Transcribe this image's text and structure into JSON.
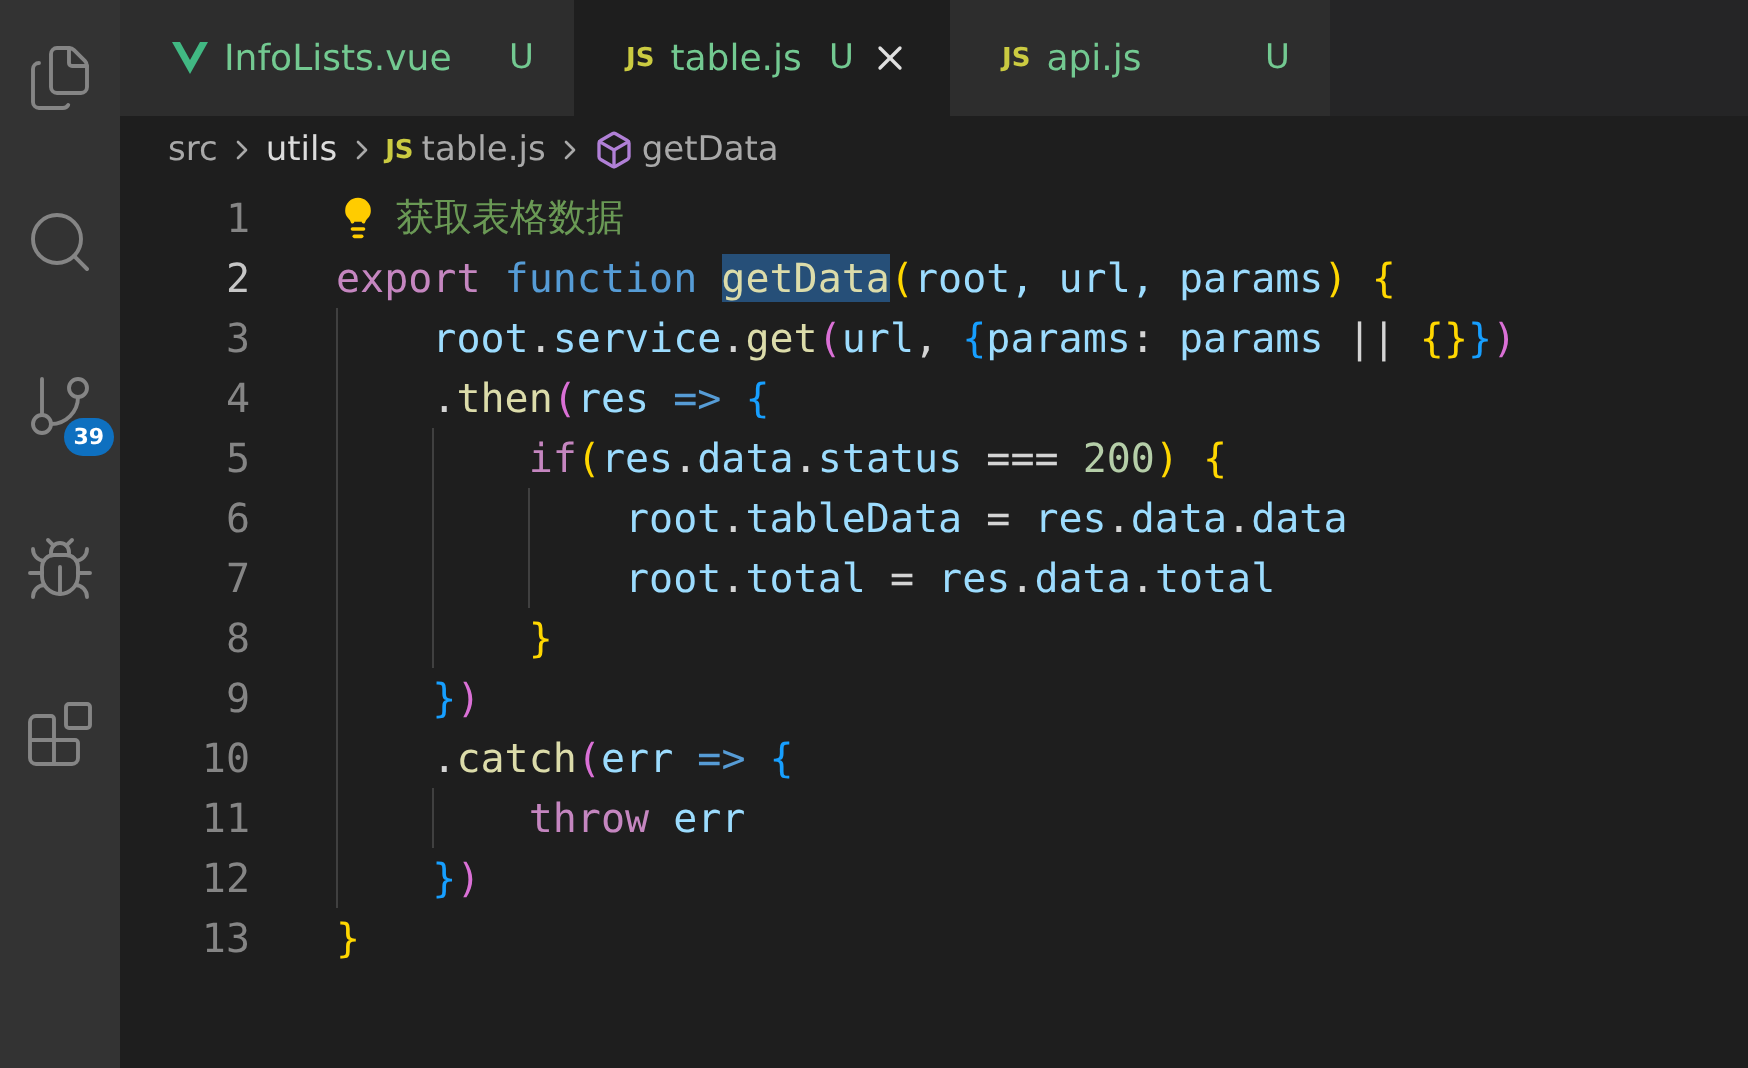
{
  "activity_bar": {
    "items": [
      {
        "kind": "files",
        "selected": false
      },
      {
        "kind": "search",
        "selected": false
      },
      {
        "kind": "source_control",
        "selected": false,
        "badge": "39"
      },
      {
        "kind": "debug",
        "selected": false
      },
      {
        "kind": "extensions",
        "selected": false
      }
    ]
  },
  "tabs": [
    {
      "kind": "vue",
      "label": "InfoLists.vue",
      "status": "U",
      "selected": false
    },
    {
      "kind": "js",
      "icon_text": "JS",
      "label": "table.js",
      "status": "U",
      "selected": true
    },
    {
      "kind": "js",
      "icon_text": "JS",
      "label": "api.js",
      "status": "U",
      "selected": false
    }
  ],
  "breadcrumb": [
    {
      "kind": "folder",
      "label": "src"
    },
    {
      "kind": "folder",
      "label": "utils"
    },
    {
      "kind": "file",
      "icon_text": "JS",
      "label": "table.js"
    },
    {
      "kind": "symbol",
      "label": "getData"
    }
  ],
  "editor": {
    "lines": [
      {
        "n": "1",
        "current": false,
        "lightbulb": true,
        "tokens": [
          {
            "t": "获取表格数据",
            "kind": "comment"
          }
        ]
      },
      {
        "n": "2",
        "current": true,
        "tokens": [
          {
            "t": "export ",
            "kind": "keyword",
            "selected": false
          },
          {
            "t": "function ",
            "kind": "storage",
            "selected": false
          },
          {
            "t": "getData",
            "kind": "func",
            "selected": true
          },
          {
            "t": "(",
            "kind": "b1",
            "selected": false
          },
          {
            "t": "root, url, params",
            "kind": "var",
            "selected": false
          },
          {
            "t": ") ",
            "kind": "b1",
            "selected": false
          },
          {
            "t": "{",
            "kind": "b1",
            "selected": false
          }
        ]
      },
      {
        "n": "3",
        "current": false,
        "tokens": [
          {
            "t": "    root",
            "kind": "var"
          },
          {
            "t": ".",
            "kind": "plain"
          },
          {
            "t": "service",
            "kind": "var"
          },
          {
            "t": ".",
            "kind": "plain"
          },
          {
            "t": "get",
            "kind": "func"
          },
          {
            "t": "(",
            "kind": "b2"
          },
          {
            "t": "url",
            "kind": "var"
          },
          {
            "t": ", ",
            "kind": "plain"
          },
          {
            "t": "{",
            "kind": "b3"
          },
          {
            "t": "params",
            "kind": "var"
          },
          {
            "t": ": ",
            "kind": "plain"
          },
          {
            "t": "params",
            "kind": "var"
          },
          {
            "t": " || ",
            "kind": "plain"
          },
          {
            "t": "{}",
            "kind": "b1"
          },
          {
            "t": "}",
            "kind": "b3"
          },
          {
            "t": ")",
            "kind": "b2"
          }
        ]
      },
      {
        "n": "4",
        "current": false,
        "tokens": [
          {
            "t": "    .",
            "kind": "plain"
          },
          {
            "t": "then",
            "kind": "func"
          },
          {
            "t": "(",
            "kind": "b2"
          },
          {
            "t": "res ",
            "kind": "var"
          },
          {
            "t": "=> ",
            "kind": "storage"
          },
          {
            "t": "{",
            "kind": "b3"
          }
        ]
      },
      {
        "n": "5",
        "current": false,
        "tokens": [
          {
            "t": "        if",
            "kind": "keyword"
          },
          {
            "t": "(",
            "kind": "b1"
          },
          {
            "t": "res",
            "kind": "var"
          },
          {
            "t": ".",
            "kind": "plain"
          },
          {
            "t": "data",
            "kind": "var"
          },
          {
            "t": ".",
            "kind": "plain"
          },
          {
            "t": "status",
            "kind": "var"
          },
          {
            "t": " === ",
            "kind": "plain"
          },
          {
            "t": "200",
            "kind": "number"
          },
          {
            "t": ") ",
            "kind": "b1"
          },
          {
            "t": "{",
            "kind": "b1"
          }
        ]
      },
      {
        "n": "6",
        "current": false,
        "tokens": [
          {
            "t": "            root",
            "kind": "var"
          },
          {
            "t": ".",
            "kind": "plain"
          },
          {
            "t": "tableData",
            "kind": "var"
          },
          {
            "t": " = ",
            "kind": "plain"
          },
          {
            "t": "res",
            "kind": "var"
          },
          {
            "t": ".",
            "kind": "plain"
          },
          {
            "t": "data",
            "kind": "var"
          },
          {
            "t": ".",
            "kind": "plain"
          },
          {
            "t": "data",
            "kind": "var"
          }
        ]
      },
      {
        "n": "7",
        "current": false,
        "tokens": [
          {
            "t": "            root",
            "kind": "var"
          },
          {
            "t": ".",
            "kind": "plain"
          },
          {
            "t": "total",
            "kind": "var"
          },
          {
            "t": " = ",
            "kind": "plain"
          },
          {
            "t": "res",
            "kind": "var"
          },
          {
            "t": ".",
            "kind": "plain"
          },
          {
            "t": "data",
            "kind": "var"
          },
          {
            "t": ".",
            "kind": "plain"
          },
          {
            "t": "total",
            "kind": "var"
          }
        ]
      },
      {
        "n": "8",
        "current": false,
        "tokens": [
          {
            "t": "        }",
            "kind": "b1"
          }
        ]
      },
      {
        "n": "9",
        "current": false,
        "tokens": [
          {
            "t": "    }",
            "kind": "b3"
          },
          {
            "t": ")",
            "kind": "b2"
          }
        ]
      },
      {
        "n": "10",
        "current": false,
        "tokens": [
          {
            "t": "    .",
            "kind": "plain"
          },
          {
            "t": "catch",
            "kind": "func"
          },
          {
            "t": "(",
            "kind": "b2"
          },
          {
            "t": "err ",
            "kind": "var"
          },
          {
            "t": "=> ",
            "kind": "storage"
          },
          {
            "t": "{",
            "kind": "b3"
          }
        ]
      },
      {
        "n": "11",
        "current": false,
        "tokens": [
          {
            "t": "        throw ",
            "kind": "keyword"
          },
          {
            "t": "err",
            "kind": "var"
          }
        ]
      },
      {
        "n": "12",
        "current": false,
        "tokens": [
          {
            "t": "    }",
            "kind": "b3"
          },
          {
            "t": ")",
            "kind": "b2"
          }
        ]
      },
      {
        "n": "13",
        "current": false,
        "tokens": [
          {
            "t": "}",
            "kind": "b1"
          }
        ]
      }
    ]
  }
}
